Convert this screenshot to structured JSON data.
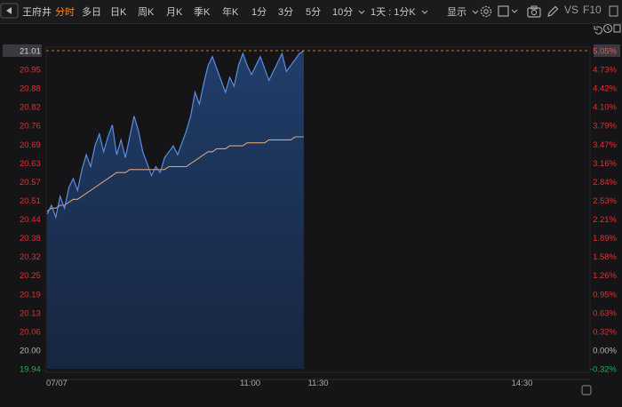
{
  "toolbar": {
    "stock_name": "王府井",
    "periods": [
      "分时",
      "多日",
      "日K",
      "周K",
      "月K",
      "季K",
      "年K",
      "1分",
      "3分",
      "5分"
    ],
    "active_period": "分时",
    "minute_select": "10分",
    "combo_select": "1天 : 1分K",
    "display_menu": "显示",
    "compare_label": "VS",
    "f10_label": "F10",
    "icons": [
      "settings-icon",
      "window-icon",
      "camera-icon",
      "pencil-icon",
      "vs-compare",
      "f10-info",
      "undo-icon",
      "history-icon",
      "expand-icon"
    ]
  },
  "colors": {
    "background": "#151517",
    "price_line": "#5b8de0",
    "avg_line": "#d9a27a",
    "area_fill": "#1e3763",
    "up": "#e0302b",
    "down": "#19b14d",
    "neutral": "#b8b8b8",
    "highlight_box": "#3a3a40",
    "grid": "#25252a"
  },
  "chart_data": {
    "type": "line",
    "title": "",
    "y_left_ticks": [
      "21.01",
      "20.95",
      "20.88",
      "20.82",
      "20.76",
      "20.69",
      "20.63",
      "20.57",
      "20.51",
      "20.44",
      "20.38",
      "20.32",
      "20.25",
      "20.19",
      "20.13",
      "20.06",
      "20.00",
      "19.94"
    ],
    "y_right_ticks": [
      "5.05%",
      "4.73%",
      "4.42%",
      "4.10%",
      "3.79%",
      "3.47%",
      "3.16%",
      "2.84%",
      "2.53%",
      "2.21%",
      "1.89%",
      "1.58%",
      "1.26%",
      "0.95%",
      "0.63%",
      "0.32%",
      "0.00%",
      "-0.32%"
    ],
    "x_ticks": [
      "07/07",
      "11:00",
      "11:30",
      "14:30"
    ],
    "prev_close": 20.0,
    "current_price": 21.01,
    "current_pct": "5.05%",
    "ylim": [
      19.94,
      21.01
    ],
    "session_minutes": 240,
    "x_tick_minutes": [
      0,
      90,
      120,
      210
    ],
    "series": [
      {
        "values": [
          20.46,
          20.49,
          20.45,
          20.52,
          20.48,
          20.55,
          20.58,
          20.54,
          20.61,
          20.66,
          20.62,
          20.69,
          20.73,
          20.67,
          20.72,
          20.76,
          20.66,
          20.71,
          20.65,
          20.72,
          20.79,
          20.74,
          20.67,
          20.63,
          20.59,
          20.62,
          20.6,
          20.65,
          20.67,
          20.69,
          20.66,
          20.7,
          20.74,
          20.79,
          20.87,
          20.83,
          20.9,
          20.96,
          20.99,
          20.95,
          20.91,
          20.87,
          20.92,
          20.89,
          20.96,
          21.0,
          20.96,
          20.93,
          20.96,
          20.99,
          20.95,
          20.91,
          20.94,
          20.97,
          21.0,
          20.94,
          20.96,
          20.98,
          21.0,
          21.01
        ]
      },
      {
        "values": [
          20.47,
          20.48,
          20.48,
          20.49,
          20.49,
          20.5,
          20.51,
          20.51,
          20.52,
          20.53,
          20.54,
          20.55,
          20.56,
          20.57,
          20.58,
          20.59,
          20.6,
          20.6,
          20.6,
          20.61,
          20.61,
          20.61,
          20.61,
          20.61,
          20.61,
          20.61,
          20.61,
          20.61,
          20.62,
          20.62,
          20.62,
          20.62,
          20.62,
          20.63,
          20.64,
          20.65,
          20.66,
          20.67,
          20.67,
          20.68,
          20.68,
          20.68,
          20.69,
          20.69,
          20.69,
          20.69,
          20.7,
          20.7,
          20.7,
          20.7,
          20.7,
          20.71,
          20.71,
          20.71,
          20.71,
          20.71,
          20.71,
          20.72,
          20.72,
          20.72
        ]
      }
    ]
  }
}
